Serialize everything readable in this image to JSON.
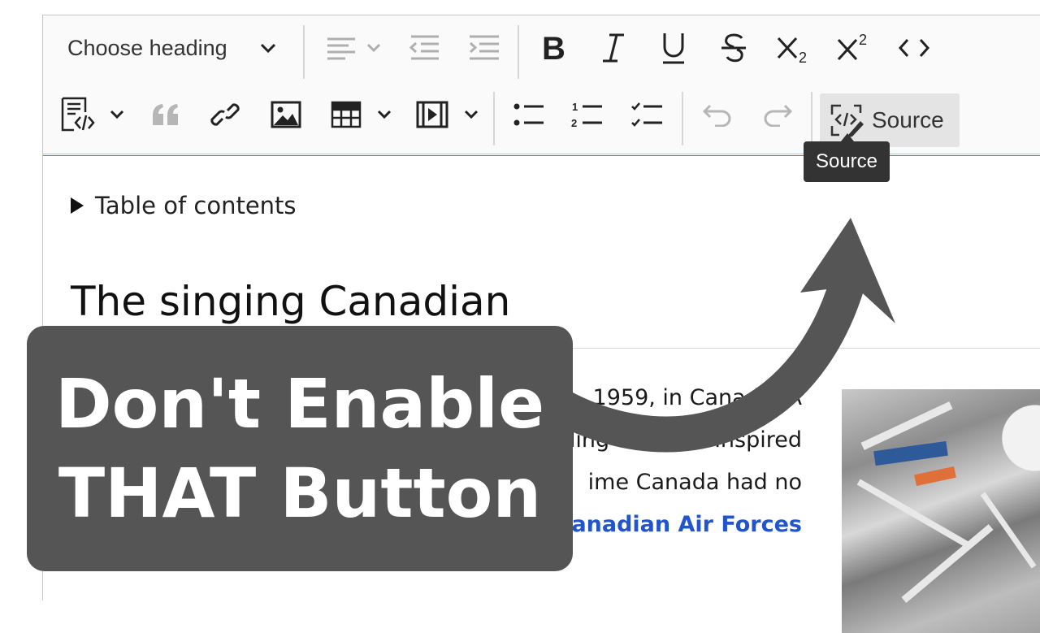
{
  "toolbar": {
    "heading_label": "Choose heading",
    "source_label": "Source"
  },
  "tooltip": {
    "text": "Source"
  },
  "content": {
    "toc_label": "Table of contents",
    "title": "The singing Canadian",
    "lines": [
      ", 1959, in Canada. A",
      "ding and was inspired",
      "ime Canada had no",
      "Canadian Air Forces"
    ]
  },
  "overlay": {
    "line1": "Don't Enable",
    "line2": "THAT Button"
  },
  "colors": {
    "overlay_bg": "#555555",
    "link": "#2255cc",
    "focus_border": "#3b8fd1"
  }
}
